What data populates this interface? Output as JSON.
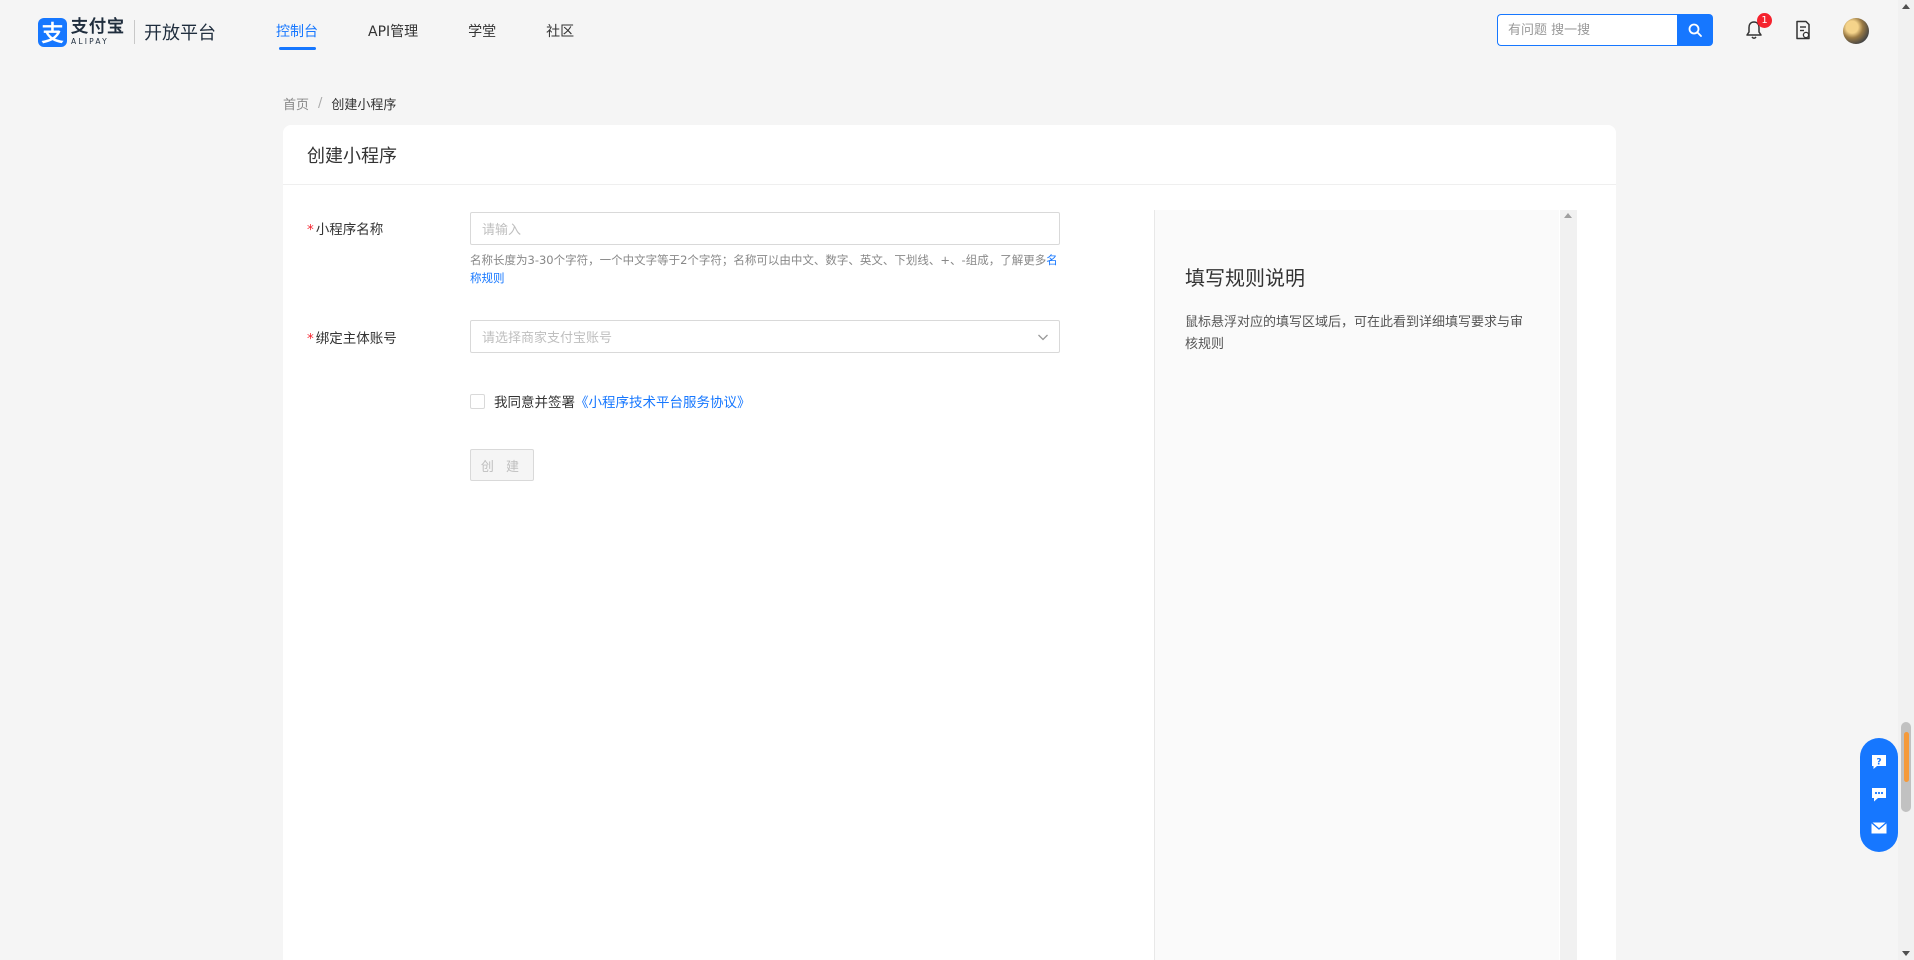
{
  "header": {
    "logo": {
      "brand_cn": "支付宝",
      "brand_en": "ALIPAY",
      "platform": "开放平台",
      "mark": "支"
    },
    "nav": [
      {
        "label": "控制台",
        "active": true
      },
      {
        "label": "API管理",
        "active": false
      },
      {
        "label": "学堂",
        "active": false
      },
      {
        "label": "社区",
        "active": false
      }
    ],
    "search": {
      "placeholder": "有问题 搜一搜",
      "value": ""
    },
    "notifications": {
      "count": "1",
      "icon": "bell-icon"
    },
    "docs_icon": "document-icon",
    "avatar_icon": "user-avatar"
  },
  "breadcrumb": {
    "home": "首页",
    "separator": "/",
    "current": "创建小程序"
  },
  "card": {
    "title": "创建小程序",
    "form": {
      "name_field": {
        "required_mark": "*",
        "label": "小程序名称",
        "placeholder": "请输入",
        "hint_text": "名称长度为3-30个字符，一个中文字等于2个字符；名称可以由中文、数字、英文、下划线、+、-组成，了解更多",
        "hint_link": "名称规则"
      },
      "account_field": {
        "required_mark": "*",
        "label": "绑定主体账号",
        "placeholder": "请选择商家支付宝账号"
      },
      "agreement": {
        "text": "我同意并签署",
        "link": "《小程序技术平台服务协议》",
        "checked": false
      },
      "create_button": "创 建"
    },
    "rules_panel": {
      "title": "填写规则说明",
      "text": "鼠标悬浮对应的填写区域后，可在此看到详细填写要求与审核规则"
    }
  },
  "floating_help": {
    "items": [
      "help-question-icon",
      "chat-icon",
      "mail-icon"
    ]
  },
  "colors": {
    "primary": "#1677ff",
    "required": "#f5222d",
    "background": "#f5f5f5"
  }
}
